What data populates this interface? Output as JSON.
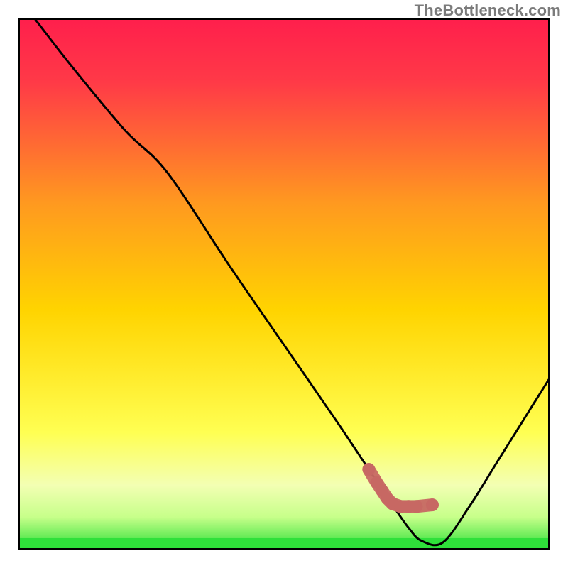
{
  "watermark": "TheBottleneck.com",
  "colors": {
    "line": "#000000",
    "marker_fill": "#c76863",
    "marker_stroke": "#c76863",
    "green_band": "#2fe03a",
    "gradient_top": "#ff1f4c",
    "gradient_mid": "#ffd400",
    "gradient_yellow": "#ffff66",
    "gradient_pale": "#f5ffd6",
    "gradient_bottom": "#2fe03a",
    "background": "#ffffff",
    "watermark": "#7b7b7b"
  },
  "chart_data": {
    "type": "line",
    "title": "",
    "xlabel": "",
    "ylabel": "",
    "xlim": [
      0,
      100
    ],
    "ylim": [
      0,
      100
    ],
    "series": [
      {
        "name": "curve",
        "x": [
          3,
          10,
          20,
          28,
          40,
          50,
          60,
          66,
          70,
          73.5,
          76,
          80,
          85,
          90,
          95,
          100
        ],
        "y": [
          100,
          91,
          79,
          71,
          53,
          38.5,
          24,
          15,
          9,
          4,
          1.5,
          1.2,
          8,
          16,
          24,
          32
        ]
      }
    ],
    "markers": {
      "name": "highlight",
      "points": [
        {
          "x": 66,
          "y": 15
        },
        {
          "x": 67.5,
          "y": 12.5
        },
        {
          "x": 68.5,
          "y": 11
        },
        {
          "x": 69.5,
          "y": 9.5
        },
        {
          "x": 70.5,
          "y": 8.5
        },
        {
          "x": 72,
          "y": 8
        },
        {
          "x": 73.5,
          "y": 8
        },
        {
          "x": 75,
          "y": 8
        },
        {
          "x": 78,
          "y": 8.3
        }
      ]
    }
  }
}
